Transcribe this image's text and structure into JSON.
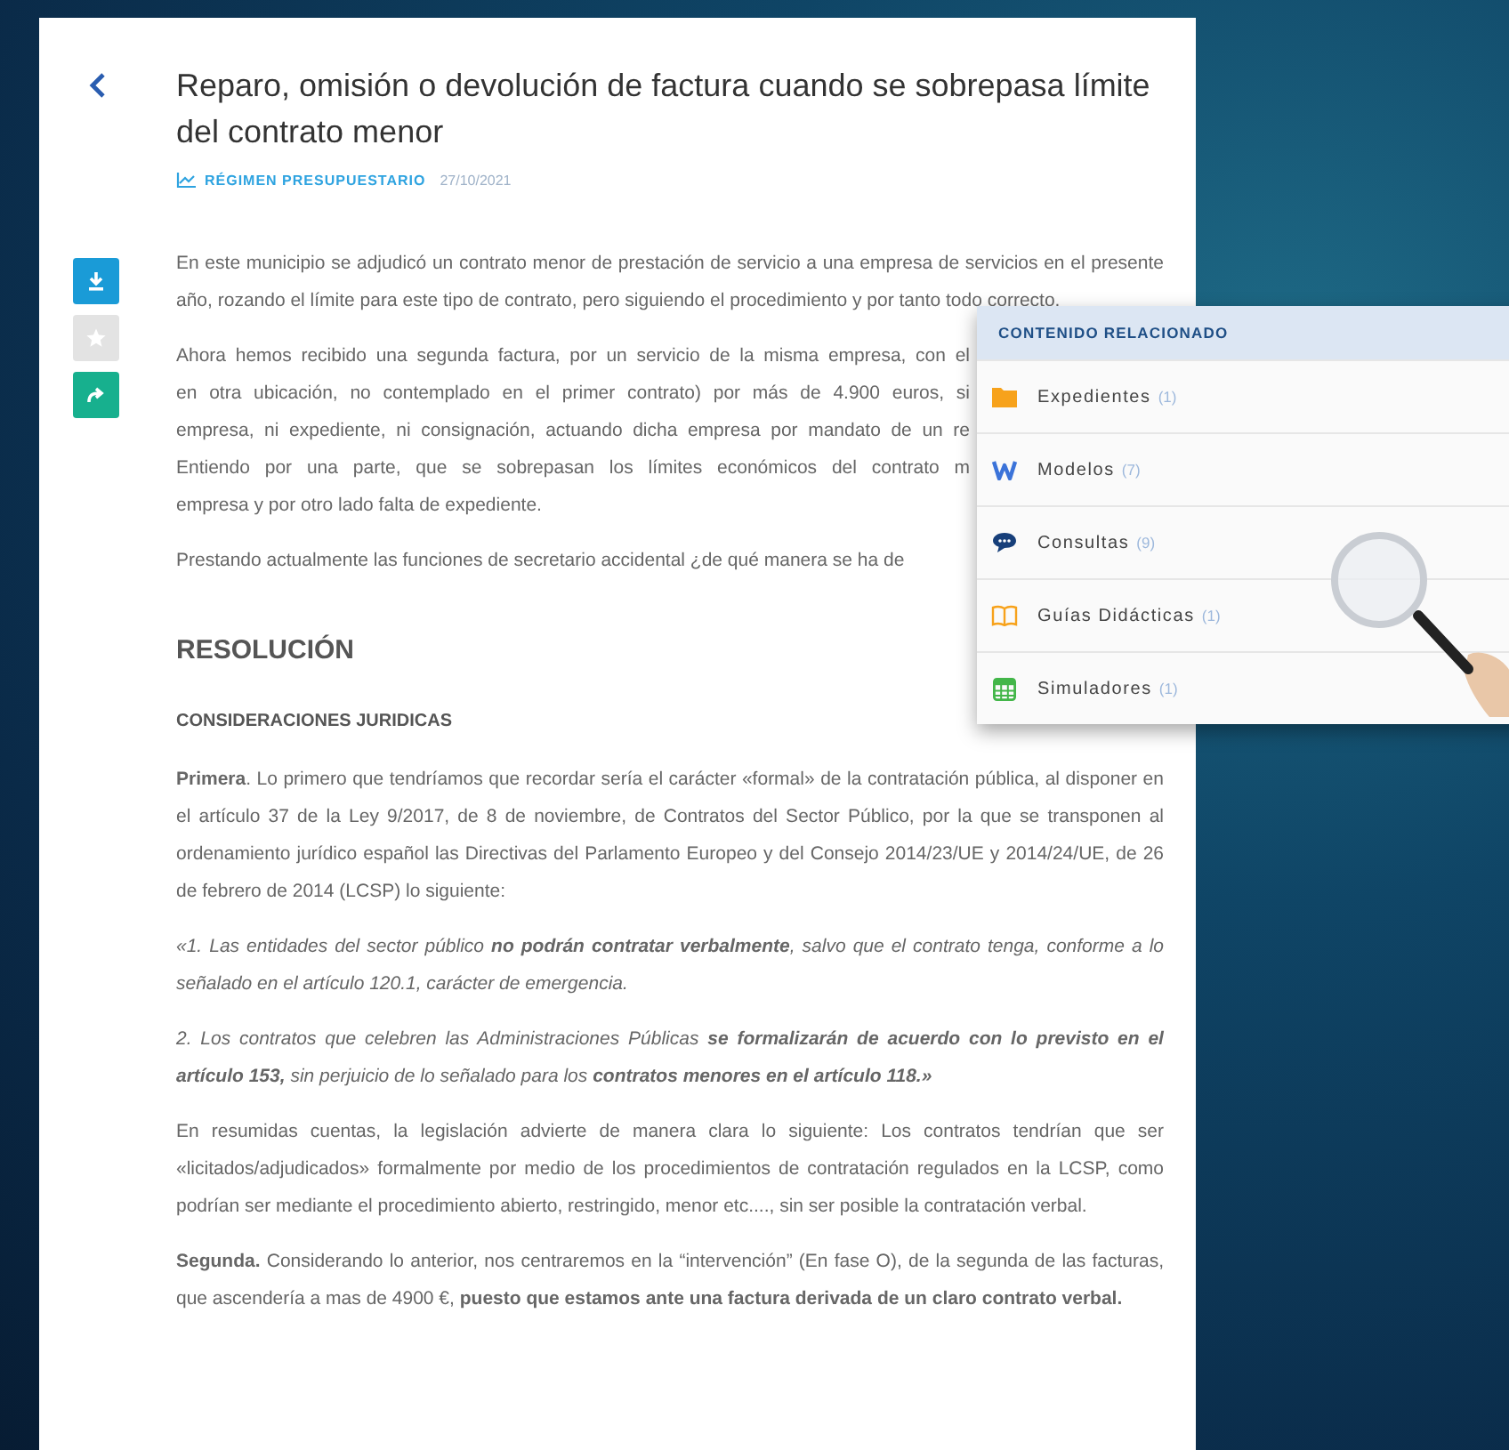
{
  "title": "Reparo, omisión o devolución de factura cuando se sobrepasa límite del contrato menor",
  "category": "RÉGIMEN PRESUPUESTARIO",
  "date": "27/10/2021",
  "actions": [
    {
      "kind": "download"
    },
    {
      "kind": "favorite"
    },
    {
      "kind": "share"
    }
  ],
  "body": [
    {
      "kind": "paragraph",
      "text": "En este municipio se adjudicó un contrato menor de prestación de servicio a una empresa de servicios en el presente año, rozando el límite para este tipo de contrato, pero siguiendo el procedimiento y por tanto todo correcto."
    },
    {
      "kind": "lines",
      "lines": [
        "Ahora hemos recibido una segunda factura, por un servicio de la misma empresa, con el",
        "en otra ubicación, no contemplado en el primer contrato) por más de 4.900 euros, si",
        "empresa, ni expediente, ni consignación, actuando dicha empresa por mandato de un re",
        "Entiendo por una parte, que se sobrepasan los límites económicos del contrato m",
        "empresa y por otro lado falta de expediente."
      ]
    },
    {
      "kind": "lines",
      "lines": [
        "Prestando actualmente las funciones de secretario accidental ¿de qué manera se ha de"
      ]
    },
    {
      "kind": "heading",
      "text": "RESOLUCIÓN"
    },
    {
      "kind": "subheading",
      "text": "CONSIDERACIONES JURIDICAS"
    },
    {
      "kind": "paragraph",
      "text": "**Primera**. Lo primero que tendríamos que recordar sería el carácter «formal» de la contratación pública, al disponer en el artículo 37 de la Ley 9/2017, de 8 de noviembre, de Contratos del Sector Público, por la que se transponen al ordenamiento jurídico español las Directivas del Parlamento Europeo y del Consejo 2014/23/UE y 2014/24/UE, de 26 de febrero de 2014 (LCSP) lo siguiente:"
    },
    {
      "kind": "quote",
      "text": "«1. Las entidades del sector público **no podrán contratar verbalmente**, salvo que el contrato tenga, conforme a lo señalado en el artículo 120.1, carácter de emergencia."
    },
    {
      "kind": "quote",
      "text": "2. Los contratos que celebren las Administraciones Públicas **se formalizarán de acuerdo con lo previsto en el artículo 153,** sin perjuicio de lo señalado para los **contratos menores en el artículo 118.»**"
    },
    {
      "kind": "paragraph",
      "text": "En resumidas cuentas, la legislación advierte de manera clara lo siguiente: Los contratos tendrían que ser «licitados/adjudicados» formalmente por medio de los procedimientos de contratación regulados en la LCSP, como podrían ser mediante el procedimiento abierto, restringido, menor etc...., sin ser posible la contratación verbal."
    },
    {
      "kind": "paragraph",
      "text": "**Segunda.** Considerando lo anterior, nos centraremos en la “intervención” (En fase O), de la segunda de las facturas, que ascendería a mas de 4900 €, **puesto que estamos ante una factura derivada de un claro contrato verbal.**"
    }
  ],
  "related": {
    "title": "CONTENIDO RELACIONADO",
    "items": [
      {
        "kind": "folder",
        "label": "Expedientes",
        "count": "(1)"
      },
      {
        "kind": "word",
        "label": "Modelos",
        "count": "(7)"
      },
      {
        "kind": "chat",
        "label": "Consultas",
        "count": "(9)"
      },
      {
        "kind": "book",
        "label": "Guías Didácticas",
        "count": "(1)"
      },
      {
        "kind": "calculator",
        "label": "Simuladores",
        "count": "(1)"
      }
    ]
  }
}
